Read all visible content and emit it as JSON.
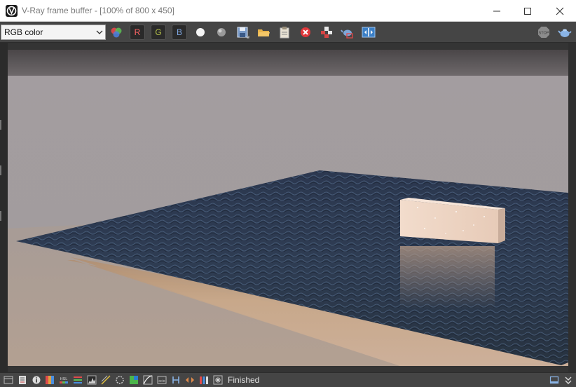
{
  "window": {
    "title": "V-Ray frame buffer - [100% of 800 x 450]"
  },
  "toolbar": {
    "channel_select": {
      "value": "RGB color"
    },
    "channel_buttons": {
      "r": "R",
      "g": "G",
      "b": "B"
    },
    "icons": [
      "color-channels-icon",
      "white-dot-icon",
      "gray-sphere-icon",
      "save-icon",
      "open-folder-icon",
      "clipboard-icon",
      "clear-red-x-icon",
      "track-mouse-icon",
      "teapot-render-region-icon",
      "compare-ab-icon",
      "stop-render-icon",
      "teapot-render-icon"
    ]
  },
  "status": {
    "text": "Finished",
    "icons": [
      "hamburger-menu-icon",
      "history-icon",
      "info-icon",
      "color-correction-icon",
      "hsl-icon",
      "levels-icon",
      "histogram-icon",
      "curves-icon",
      "exposure-icon",
      "lut-icon",
      "curve-icon",
      "ocio-icon",
      "h-icon",
      "horizontal-flip-icon",
      "rgb-bars-icon",
      "lens-effects-icon",
      "panel-toggle-icon",
      "expand-icon"
    ]
  },
  "colors": {
    "toolbar_bg": "#454545",
    "sky": "#a19b9d",
    "water": "#2c3a4d",
    "shadow": "#c8aa90",
    "block": "#ecd5c6"
  }
}
